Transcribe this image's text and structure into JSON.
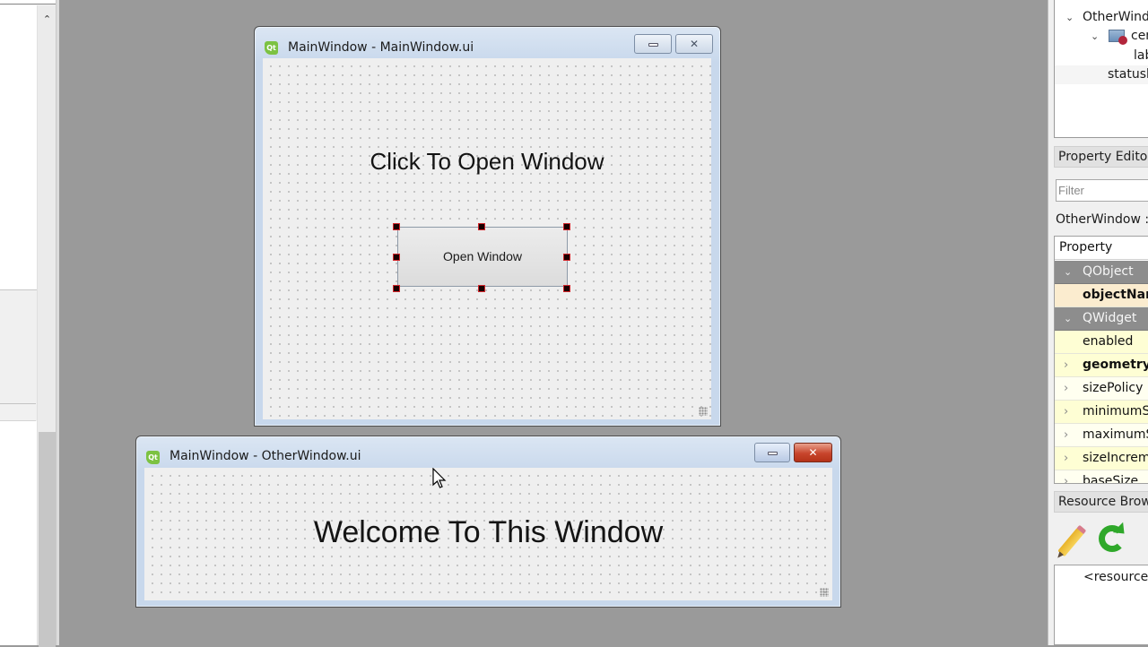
{
  "left_dock": {
    "scroll_up_glyph": "⌃"
  },
  "form_main": {
    "title": "MainWindow - MainWindow.ui",
    "icon": "qt-logo-icon",
    "icon_text": "Qt",
    "minimize_glyph": "▭",
    "close_glyph": "✕",
    "label_text": "Click To Open Window",
    "button_text": "Open Window",
    "button_selected": true
  },
  "form_other": {
    "title": "MainWindow - OtherWindow.ui",
    "icon": "qt-logo-icon",
    "icon_text": "Qt",
    "close_glyph": "✕",
    "label_text": "Welcome To This Window",
    "active": true
  },
  "object_inspector": {
    "items": [
      {
        "label": "OtherWindow",
        "expanded": true,
        "depth": 0
      },
      {
        "label": "centralwidget",
        "expanded": true,
        "depth": 1,
        "icon": "widget-layout-broken-icon"
      },
      {
        "label": "label",
        "depth": 2
      },
      {
        "label": "statusbar",
        "depth": 1
      }
    ]
  },
  "property_editor": {
    "title": "Property Editor",
    "filter_placeholder": "Filter",
    "class_line": "OtherWindow : QMainWindow",
    "header": "Property",
    "rows": [
      {
        "name": "QObject",
        "type": "group"
      },
      {
        "name": "objectName",
        "type": "changed",
        "bold": true
      },
      {
        "name": "QWidget",
        "type": "group"
      },
      {
        "name": "enabled",
        "type": "yellow"
      },
      {
        "name": "geometry",
        "type": "yellow",
        "bold": true,
        "expandable": true
      },
      {
        "name": "sizePolicy",
        "type": "light",
        "expandable": true
      },
      {
        "name": "minimumSize",
        "type": "yellow",
        "expandable": true
      },
      {
        "name": "maximumSize",
        "type": "light",
        "expandable": true
      },
      {
        "name": "sizeIncrement",
        "type": "yellow",
        "expandable": true
      },
      {
        "name": "baseSize",
        "type": "light",
        "expandable": true
      }
    ]
  },
  "resource_browser": {
    "title": "Resource Browser",
    "edit_icon": "pencil-icon",
    "reload_icon": "reload-icon",
    "root_item": "<resource root>"
  }
}
